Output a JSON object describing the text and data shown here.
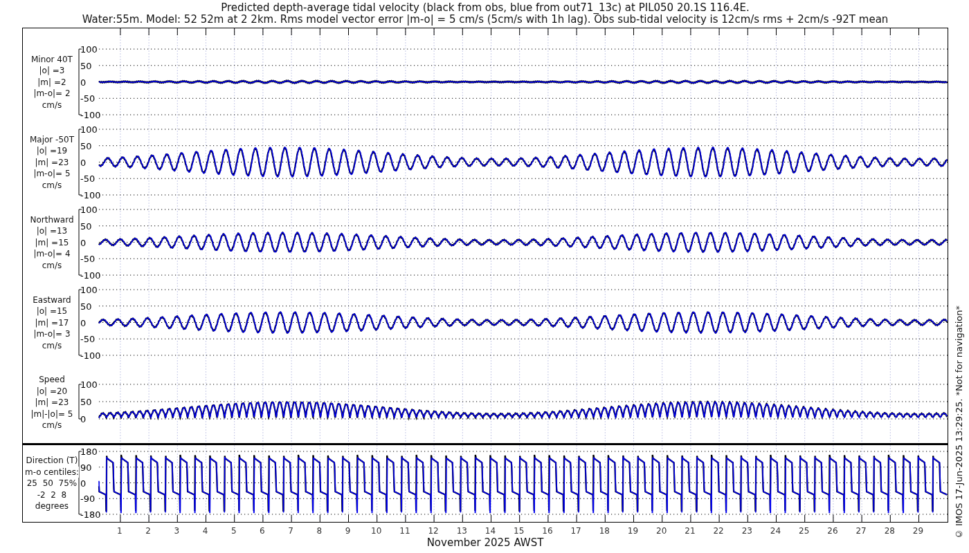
{
  "title": [
    "Predicted depth-average tidal velocity (black from obs, blue from out71_13c) at PIL050 20.1S 116.4E.",
    "Water:55m. Model: 52 52m at 2 2km. Rms model vector error |m-o| = 5 cm/s (5cm/s with 1h lag). Obs sub-tidal velocity is 12cm/s rms + 2cm/s -92T mean"
  ],
  "panels": [
    {
      "kind": "velocity",
      "label": [
        "Minor 40T",
        "|o| =3",
        "|m| =2",
        "|m-o|= 2",
        "cm/s"
      ],
      "yticks": [
        "100",
        "50",
        "0",
        "-50",
        "-100"
      ]
    },
    {
      "kind": "velocity",
      "label": [
        "Major -50T",
        "|o| =19",
        "|m| =23",
        "|m-o|= 5",
        "cm/s"
      ],
      "yticks": [
        "100",
        "50",
        "0",
        "-50",
        "-100"
      ]
    },
    {
      "kind": "velocity",
      "label": [
        "Northward",
        "|o| =13",
        "|m| =15",
        "|m-o|= 4",
        "cm/s"
      ],
      "yticks": [
        "100",
        "50",
        "0",
        "-50",
        "-100"
      ]
    },
    {
      "kind": "velocity",
      "label": [
        "Eastward",
        "|o| =15",
        "|m| =17",
        "|m-o|= 3",
        "cm/s"
      ],
      "yticks": [
        "100",
        "50",
        "0",
        "-50",
        "-100"
      ]
    },
    {
      "kind": "speed",
      "label": [
        "Speed",
        "|o| =20",
        "|m| =23",
        "|m|-|o|= 5",
        "cm/s"
      ],
      "yticks": [
        "100",
        "50",
        "0"
      ]
    }
  ],
  "direction_panel": {
    "kind": "direction",
    "label": [
      "Direction (T)",
      "m-o centiles:",
      "25  50  75%",
      "-2  2  8",
      "degrees"
    ],
    "yticks": [
      "180",
      "90",
      "0",
      "-90",
      "-180"
    ]
  },
  "xticks": [
    "1",
    "2",
    "3",
    "4",
    "5",
    "6",
    "7",
    "8",
    "9",
    "10",
    "11",
    "12",
    "13",
    "14",
    "15",
    "16",
    "17",
    "18",
    "19",
    "20",
    "21",
    "22",
    "23",
    "24",
    "25",
    "26",
    "27",
    "28",
    "29"
  ],
  "xlabel": "November 2025 AWST",
  "credit": "© IMOS 17-Jun-2025 13:29:25. *Not for navigation*"
}
